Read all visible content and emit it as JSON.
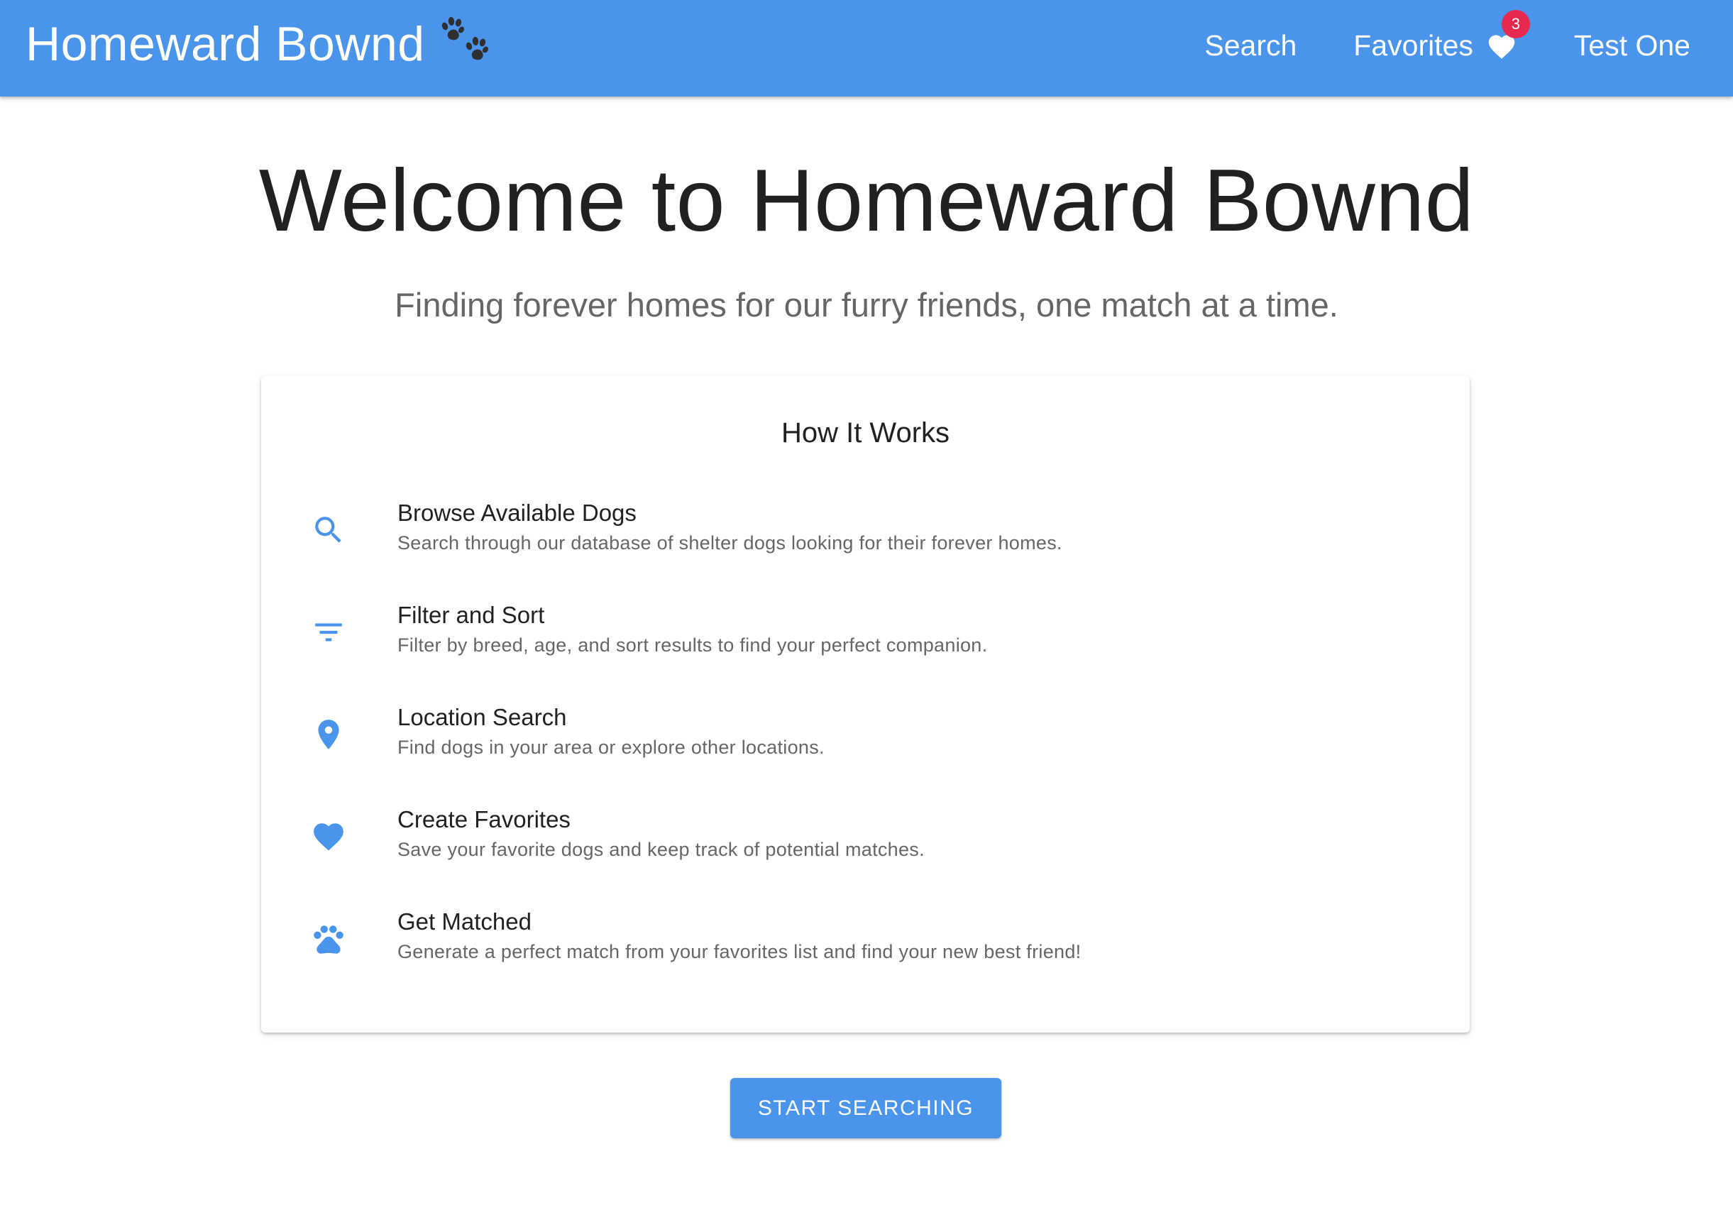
{
  "colors": {
    "primary": "#4a94ec",
    "badge": "#e8294f",
    "paw_icon": "#2f2f2f",
    "text_primary": "#212121",
    "text_secondary": "#666666"
  },
  "header": {
    "brand_title": "Homeward Bownd",
    "brand_icon": "paw-prints-icon",
    "nav": {
      "search_label": "Search",
      "favorites_label": "Favorites",
      "favorites_icon": "heart-icon",
      "favorites_count": "3",
      "user_label": "Test One"
    }
  },
  "hero": {
    "title": "Welcome to Homeward Bownd",
    "subtitle": "Finding forever homes for our furry friends, one match at a time."
  },
  "how_it_works": {
    "title": "How It Works",
    "steps": [
      {
        "icon": "search-icon",
        "heading": "Browse Available Dogs",
        "description": "Search through our database of shelter dogs looking for their forever homes."
      },
      {
        "icon": "filter-icon",
        "heading": "Filter and Sort",
        "description": "Filter by breed, age, and sort results to find your perfect companion."
      },
      {
        "icon": "location-pin-icon",
        "heading": "Location Search",
        "description": "Find dogs in your area or explore other locations."
      },
      {
        "icon": "heart-icon",
        "heading": "Create Favorites",
        "description": "Save your favorite dogs and keep track of potential matches."
      },
      {
        "icon": "paw-icon",
        "heading": "Get Matched",
        "description": "Generate a perfect match from your favorites list and find your new best friend!"
      }
    ]
  },
  "cta": {
    "label": "START SEARCHING"
  }
}
